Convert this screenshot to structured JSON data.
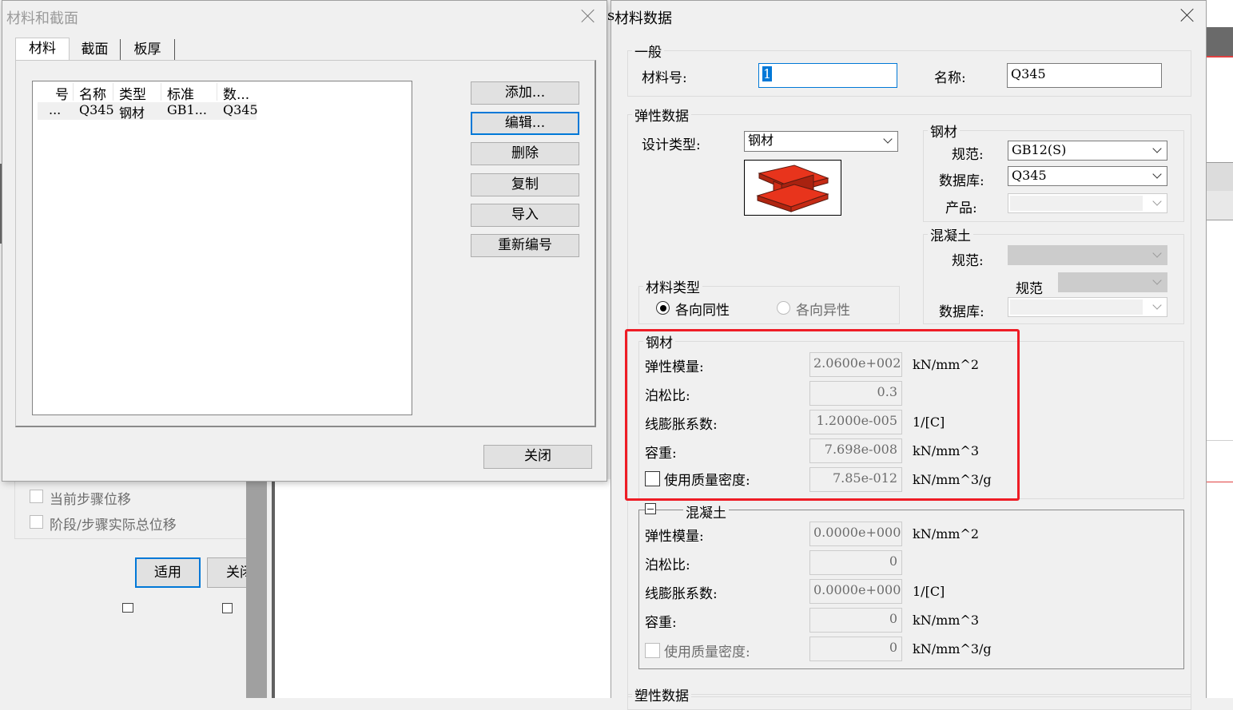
{
  "background": {
    "checkbox1_label": "当前步骤位移",
    "checkbox2_label": "阶段/步骤实际总位移",
    "apply_button": "适用",
    "close_button_partial": "关闭"
  },
  "mat_section_dialog": {
    "title": "材料和截面",
    "tabs": [
      "材料",
      "截面",
      "板厚"
    ],
    "list": {
      "headers": [
        "号",
        "名称",
        "类型",
        "标准",
        "数..."
      ],
      "rows": [
        {
          "no": "...",
          "name": "Q345",
          "type": "钢材",
          "std": "GB1...",
          "db": "Q345"
        }
      ]
    },
    "buttons": {
      "add": "添加...",
      "edit": "编辑...",
      "delete": "删除",
      "copy": "复制",
      "import": "导入",
      "renumber": "重新编号",
      "close": "关闭"
    }
  },
  "material_dialog": {
    "title": "材料数据",
    "title_prefix": "s",
    "general": {
      "group": "一般",
      "id_label": "材料号:",
      "id_value": "1",
      "name_label": "名称:",
      "name_value": "Q345"
    },
    "elastic": {
      "group": "弹性数据",
      "design_type_label": "设计类型:",
      "design_type_value": "钢材",
      "steel_group": "钢材",
      "code_label": "规范:",
      "code_value": "GB12(S)",
      "db_label": "数据库:",
      "db_value": "Q345",
      "product_label": "产品:",
      "concrete_group": "混凝土",
      "c_code_label": "规范:",
      "c_code2_label": "规范",
      "c_db_label": "数据库:",
      "mat_type_group": "材料类型",
      "iso_label": "各向同性",
      "aniso_label": "各向异性"
    },
    "steel": {
      "group": "钢材",
      "rows": [
        {
          "label": "弹性模量:",
          "value": "2.0600e+002",
          "unit": "kN/mm^2"
        },
        {
          "label": "泊松比:",
          "value": "0.3",
          "unit": ""
        },
        {
          "label": "线膨胀系数:",
          "value": "1.2000e-005",
          "unit": "1/[C]"
        },
        {
          "label": "容重:",
          "value": "7.698e-008",
          "unit": "kN/mm^3"
        },
        {
          "label": "使用质量密度:",
          "value": "7.85e-012",
          "unit": "kN/mm^3/g"
        }
      ]
    },
    "concrete": {
      "group": "混凝土",
      "rows": [
        {
          "label": "弹性模量:",
          "value": "0.0000e+000",
          "unit": "kN/mm^2"
        },
        {
          "label": "泊松比:",
          "value": "0",
          "unit": ""
        },
        {
          "label": "线膨胀系数:",
          "value": "0.0000e+000",
          "unit": "1/[C]"
        },
        {
          "label": "容重:",
          "value": "0",
          "unit": "kN/mm^3"
        },
        {
          "label": "使用质量密度:",
          "value": "0",
          "unit": "kN/mm^3/g"
        }
      ]
    },
    "plastic_group": "塑性数据"
  },
  "colors": {
    "highlight_box": "#ee1c25",
    "focus_border": "#0078d7",
    "beam_red": "#e8341c"
  }
}
